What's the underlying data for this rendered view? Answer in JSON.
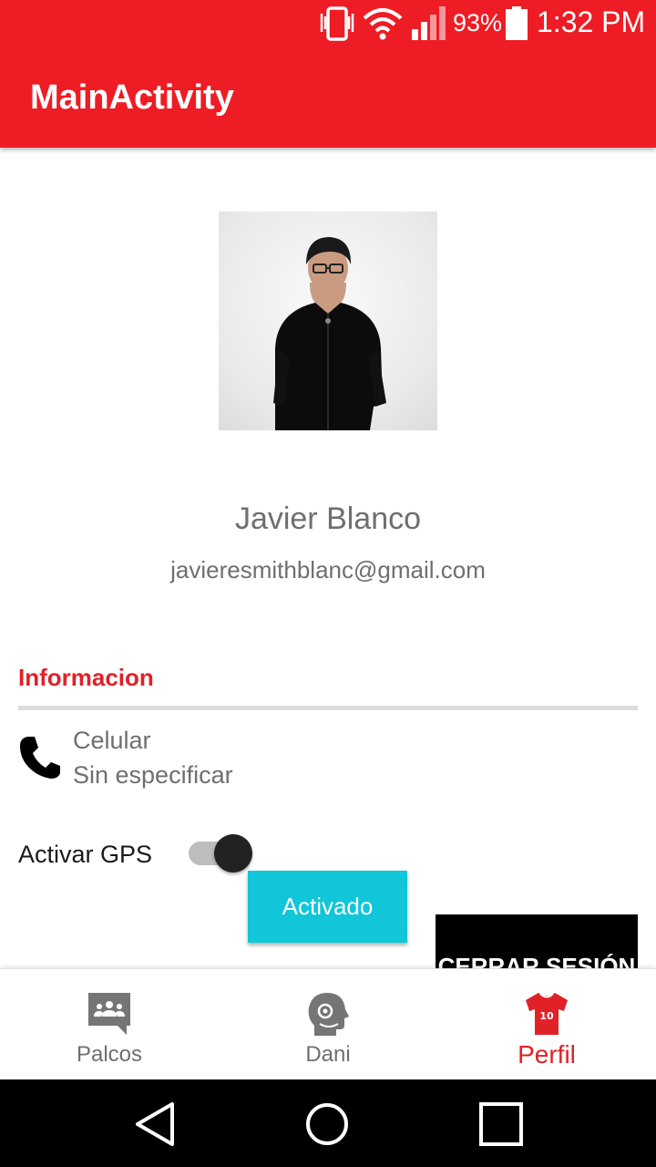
{
  "status_bar": {
    "battery_percent": "93%",
    "time": "1:32 PM"
  },
  "app_bar": {
    "title": "MainActivity",
    "color": "#ee1c24"
  },
  "profile": {
    "name": "Javier Blanco",
    "email": "javieresmithblanc@gmail.com"
  },
  "info_section": {
    "title": "Informacion",
    "phone_label": "Celular",
    "phone_value": "Sin especificar"
  },
  "gps": {
    "label": "Activar GPS",
    "enabled": true,
    "status_button_label": "Activado",
    "status_button_color": "#10c6d8"
  },
  "logout_button_label": "CERRAR SESIÓN",
  "bottom_nav": {
    "items": [
      {
        "label": "Palcos",
        "icon": "group-chat-icon",
        "active": false
      },
      {
        "label": "Dani",
        "icon": "assistant-head-icon",
        "active": false
      },
      {
        "label": "Perfil",
        "icon": "jersey-icon",
        "active": true
      }
    ],
    "active_color": "#e02128"
  },
  "system_nav": {
    "buttons": [
      "back-icon",
      "home-icon",
      "recents-icon"
    ]
  }
}
